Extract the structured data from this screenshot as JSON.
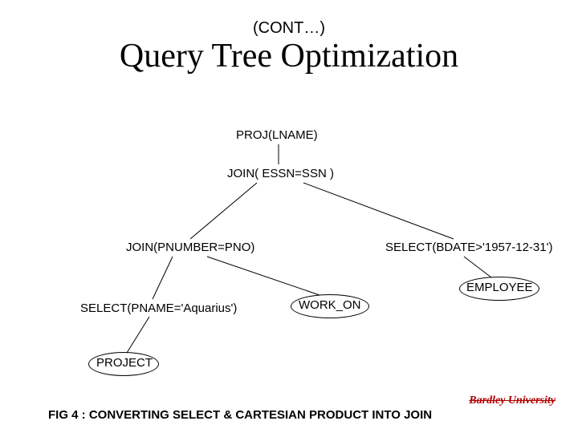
{
  "header": {
    "cont": "(CONT…)",
    "title": "Query Tree Optimization"
  },
  "nodes": {
    "proj": "PROJ(LNAME)",
    "join1": "JOIN( ESSN=SSN )",
    "join2": "JOIN(PNUMBER=PNO)",
    "sel_bdate": "SELECT(BDATE>'1957-12-31')",
    "sel_pname": "SELECT(PNAME='Aquarius')",
    "work_on": "WORK_ON",
    "employee": "EMPLOYEE",
    "project": "PROJECT"
  },
  "caption": "FIG 4 : CONVERTING SELECT & CARTESIAN PRODUCT INTO JOIN",
  "brand": "Bardley University"
}
